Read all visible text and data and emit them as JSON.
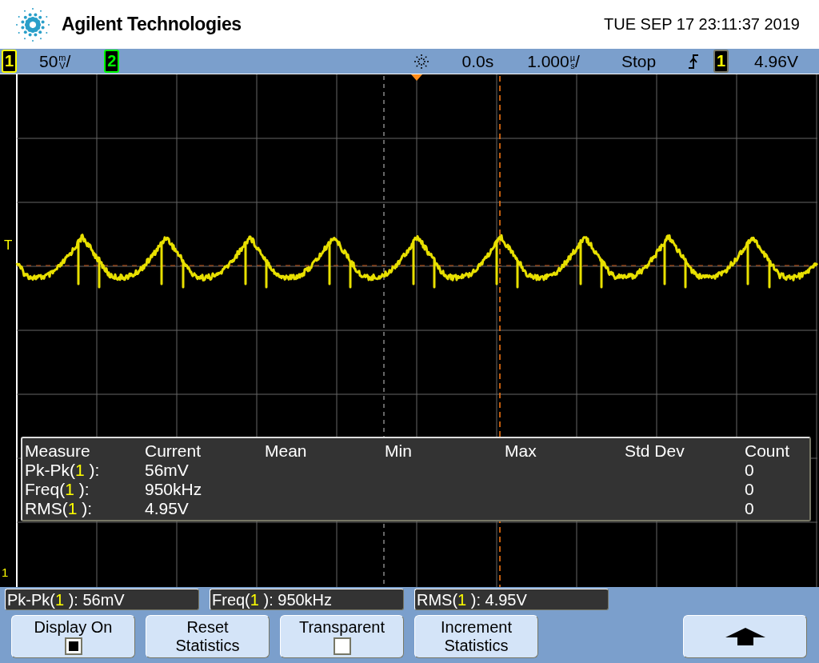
{
  "header": {
    "brand": "Agilent Technologies",
    "datetime": "TUE SEP 17 23:11:37 2019"
  },
  "status_bar": {
    "channels": [
      {
        "number": "1",
        "color": "#ffff00",
        "scale": {
          "value": "50",
          "unit_top": "m",
          "unit_bottom": "V",
          "suffix": "/"
        }
      },
      {
        "number": "2",
        "color": "#00ff00"
      }
    ],
    "delay": "0.0s",
    "timebase": {
      "value": "1.000",
      "unit_top": "µ",
      "unit_bottom": "s",
      "suffix": "/"
    },
    "run_state": "Stop",
    "trigger": {
      "source": "1",
      "level": "4.96V"
    }
  },
  "plot": {
    "markers": {
      "trigger_level": "T",
      "ground": "1"
    }
  },
  "measurements_table": {
    "columns": [
      "Measure",
      "Current",
      "Mean",
      "Min",
      "Max",
      "Std Dev",
      "Count"
    ],
    "rows": [
      {
        "prefix": "Pk-Pk(",
        "channel": "1",
        "suffix": " ):",
        "current": "56mV",
        "count": "0"
      },
      {
        "prefix": "Freq(",
        "channel": "1",
        "suffix": " ):",
        "current": "950kHz",
        "count": "0"
      },
      {
        "prefix": "RMS(",
        "channel": "1",
        "suffix": " ):",
        "current": "4.95V",
        "count": "0"
      }
    ]
  },
  "measurement_strip": [
    {
      "prefix": "Pk-Pk(",
      "channel": "1",
      "suffix": " ): 56mV"
    },
    {
      "prefix": "Freq(",
      "channel": "1",
      "suffix": " ): 950kHz"
    },
    {
      "prefix": "RMS(",
      "channel": "1",
      "suffix": " ): 4.95V"
    }
  ],
  "softkeys": [
    {
      "kind": "checkbox",
      "label": "Display On",
      "checked": true
    },
    {
      "kind": "button",
      "label": "Reset\nStatistics"
    },
    {
      "kind": "checkbox",
      "label": "Transparent",
      "checked": false
    },
    {
      "kind": "button",
      "label": "Increment\nStatistics"
    },
    {
      "kind": "arrow"
    }
  ]
}
